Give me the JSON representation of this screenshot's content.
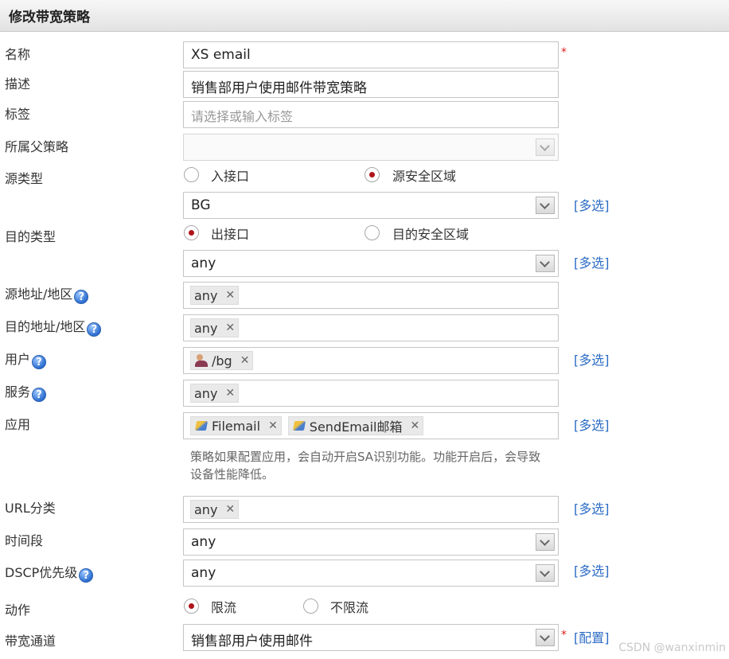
{
  "header": {
    "title": "修改带宽策略"
  },
  "form": {
    "name": {
      "label": "名称",
      "value": "XS email"
    },
    "desc": {
      "label": "描述",
      "value": "销售部用户使用邮件带宽策略"
    },
    "tag": {
      "label": "标签",
      "placeholder": "请选择或输入标签"
    },
    "parent": {
      "label": "所属父策略",
      "value": ""
    },
    "src_type": {
      "label": "源类型",
      "opt1": "入接口",
      "opt2": "源安全区域",
      "selected": "源安全区域",
      "value": "BG"
    },
    "dst_type": {
      "label": "目的类型",
      "opt1": "出接口",
      "opt2": "目的安全区域",
      "selected": "出接口",
      "value": "any"
    },
    "src_addr": {
      "label": "源地址/地区",
      "tags": [
        "any"
      ]
    },
    "dst_addr": {
      "label": "目的地址/地区",
      "tags": [
        "any"
      ]
    },
    "user": {
      "label": "用户",
      "tags": [
        "/bg"
      ]
    },
    "service": {
      "label": "服务",
      "tags": [
        "any"
      ]
    },
    "app": {
      "label": "应用",
      "tags": [
        "Filemail",
        "SendEmail邮箱"
      ],
      "hint": "策略如果配置应用，会自动开启SA识别功能。功能开启后，会导致设备性能降低。"
    },
    "url": {
      "label": "URL分类",
      "tags": [
        "any"
      ]
    },
    "time": {
      "label": "时间段",
      "value": "any"
    },
    "dscp": {
      "label": "DSCP优先级",
      "value": "any"
    },
    "action": {
      "label": "动作",
      "opt1": "限流",
      "opt2": "不限流",
      "selected": "限流"
    },
    "channel": {
      "label": "带宽通道",
      "value": "销售部用户使用邮件"
    }
  },
  "links": {
    "multi": "[多选]",
    "config": "[配置]"
  },
  "required_mark": "*",
  "help_mark": "?",
  "remove_mark": "✕",
  "watermark": "CSDN @wanxinmin"
}
